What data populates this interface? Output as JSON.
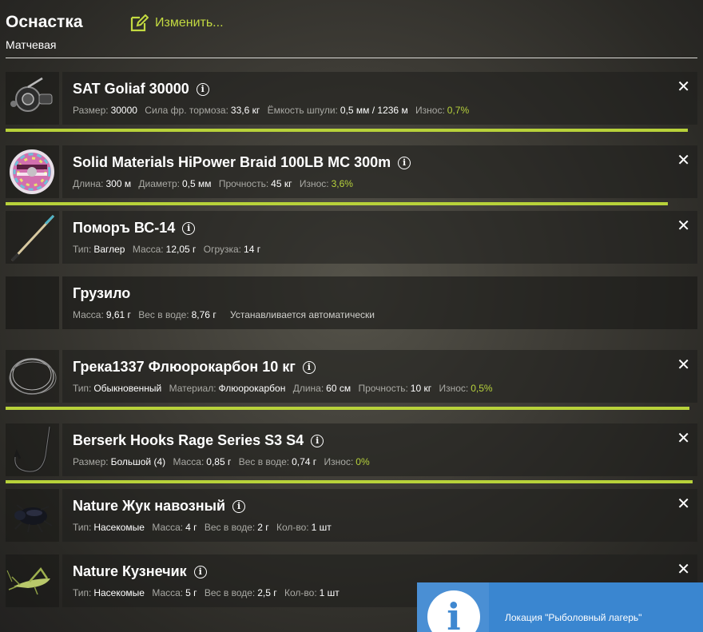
{
  "header": {
    "title": "Оснастка",
    "subtitle": "Матчевая",
    "edit_label": "Изменить..."
  },
  "items": [
    {
      "name": "SAT Goliaf 30000",
      "props": [
        [
          "Размер:",
          "30000"
        ],
        [
          "Сила фр. тормоза:",
          "33,6 кг"
        ],
        [
          "Ёмкость шпули:",
          "0,5 мм / 1236 м"
        ]
      ],
      "wear_label": "Износ:",
      "wear": "0,7%",
      "bar_fraction": 0.993
    },
    {
      "name": "Solid Materials HiPower Braid 100LB MC 300m",
      "props": [
        [
          "Длина:",
          "300 м"
        ],
        [
          "Диаметр:",
          "0,5 мм"
        ],
        [
          "Прочность:",
          "45 кг"
        ]
      ],
      "wear_label": "Износ:",
      "wear": "3,6%",
      "bar_fraction": 0.964
    },
    {
      "name": "Поморъ ВС-14",
      "props": [
        [
          "Тип:",
          "Ваглер"
        ],
        [
          "Масса:",
          "12,05 г"
        ],
        [
          "Огрузка:",
          "14 г"
        ]
      ]
    },
    {
      "name": "Грузило",
      "props": [
        [
          "Масса:",
          "9,61 г"
        ],
        [
          "Вес в воде:",
          "8,76 г"
        ]
      ],
      "note": "Устанавливается автоматически"
    },
    {
      "name": "Грека1337 Флюорокарбон 10 кг",
      "props": [
        [
          "Тип:",
          "Обыкновенный"
        ],
        [
          "Материал:",
          "Флюорокарбон"
        ],
        [
          "Длина:",
          "60 см"
        ],
        [
          "Прочность:",
          "10 кг"
        ]
      ],
      "wear_label": "Износ:",
      "wear": "0,5%",
      "bar_fraction": 0.995
    },
    {
      "name": "Berserk Hooks Rage Series S3 S4",
      "props": [
        [
          "Размер:",
          "Большой (4)"
        ],
        [
          "Масса:",
          "0,85 г"
        ],
        [
          "Вес в воде:",
          "0,74 г"
        ]
      ],
      "wear_label": "Износ:",
      "wear": "0%",
      "bar_fraction": 1.0
    },
    {
      "name": "Nature Жук навозный",
      "props": [
        [
          "Тип:",
          "Насекомые"
        ],
        [
          "Масса:",
          "4 г"
        ],
        [
          "Вес в воде:",
          "2 г"
        ],
        [
          "Кол-во:",
          "1 шт"
        ]
      ]
    },
    {
      "name": "Nature Кузнечик",
      "props": [
        [
          "Тип:",
          "Насекомые"
        ],
        [
          "Масса:",
          "5 г"
        ],
        [
          "Вес в воде:",
          "2,5 г"
        ],
        [
          "Кол-во:",
          "1 шт"
        ]
      ]
    }
  ],
  "toast": {
    "message": "Локация \"Рыболовный лагерь\"",
    "icon": "info-icon"
  },
  "icons": [
    "edit-icon",
    "reel-icon",
    "line-spool-icon",
    "float-icon",
    "sinker-icon",
    "leader-icon",
    "hook-icon",
    "beetle-icon",
    "grasshopper-icon",
    "info-icon",
    "close-icon"
  ],
  "colors": {
    "accent": "#b8d23a",
    "toast": "#3a86d0"
  }
}
